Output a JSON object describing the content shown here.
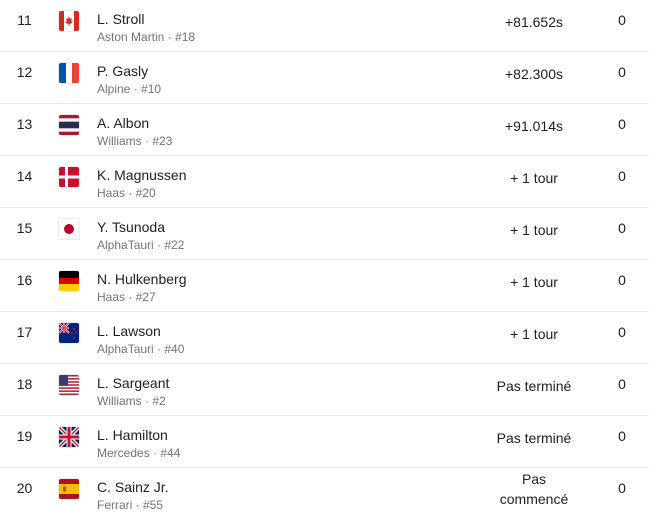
{
  "results": [
    {
      "pos": "11",
      "driver": "L. Stroll",
      "team": "Aston Martin · #18",
      "time": "+81.652s",
      "points": "0",
      "flag": "canada-flag-icon"
    },
    {
      "pos": "12",
      "driver": "P. Gasly",
      "team": "Alpine · #10",
      "time": "+82.300s",
      "points": "0",
      "flag": "france-flag-icon"
    },
    {
      "pos": "13",
      "driver": "A. Albon",
      "team": "Williams · #23",
      "time": "+91.014s",
      "points": "0",
      "flag": "thailand-flag-icon"
    },
    {
      "pos": "14",
      "driver": "K. Magnussen",
      "team": "Haas · #20",
      "time": "+ 1 tour",
      "points": "0",
      "flag": "denmark-flag-icon"
    },
    {
      "pos": "15",
      "driver": "Y. Tsunoda",
      "team": "AlphaTauri · #22",
      "time": "+ 1 tour",
      "points": "0",
      "flag": "japan-flag-icon"
    },
    {
      "pos": "16",
      "driver": "N. Hulkenberg",
      "team": "Haas · #27",
      "time": "+ 1 tour",
      "points": "0",
      "flag": "germany-flag-icon"
    },
    {
      "pos": "17",
      "driver": "L. Lawson",
      "team": "AlphaTauri · #40",
      "time": "+ 1 tour",
      "points": "0",
      "flag": "new-zealand-flag-icon"
    },
    {
      "pos": "18",
      "driver": "L. Sargeant",
      "team": "Williams · #2",
      "time": "Pas terminé",
      "points": "0",
      "flag": "usa-flag-icon"
    },
    {
      "pos": "19",
      "driver": "L. Hamilton",
      "team": "Mercedes · #44",
      "time": "Pas terminé",
      "points": "0",
      "flag": "uk-flag-icon"
    },
    {
      "pos": "20",
      "driver": "C. Sainz Jr.",
      "team": "Ferrari · #55",
      "time_line1": "Pas",
      "time_line2": "commencé",
      "points": "0",
      "flag": "spain-flag-icon"
    }
  ],
  "colors": {
    "text": "#202124",
    "muted": "#70757a",
    "divider": "#e8eaed"
  }
}
